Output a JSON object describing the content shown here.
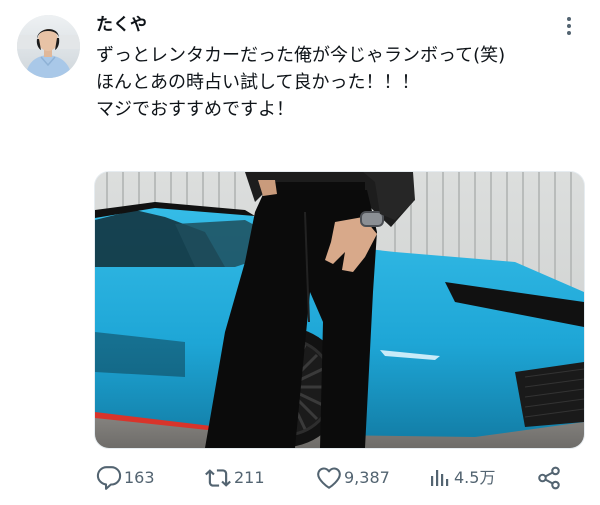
{
  "tweet": {
    "author": {
      "display_name": "たくや",
      "avatar": "avatar-photo"
    },
    "more_icon": "more-dots-icon",
    "text_lines": [
      "ずっとレンタカーだった俺が今じゃランボって(笑)",
      "ほんとあの時占い試して良かった！！！",
      "マジでおすすめですよ！"
    ],
    "media": {
      "type": "photo",
      "subject": "man-in-black-jeans-leaning-on-blue-sports-car"
    },
    "actions": {
      "reply": {
        "icon": "reply-icon",
        "count": "163"
      },
      "repost": {
        "icon": "repost-icon",
        "count": "211"
      },
      "like": {
        "icon": "heart-icon",
        "count": "9,387"
      },
      "views": {
        "icon": "views-chart-icon",
        "count": "4.5万"
      },
      "share": {
        "icon": "share-icon"
      }
    },
    "colors": {
      "text": "#0f1419",
      "secondary": "#536471",
      "car_blue": "#1ea6d6"
    }
  }
}
